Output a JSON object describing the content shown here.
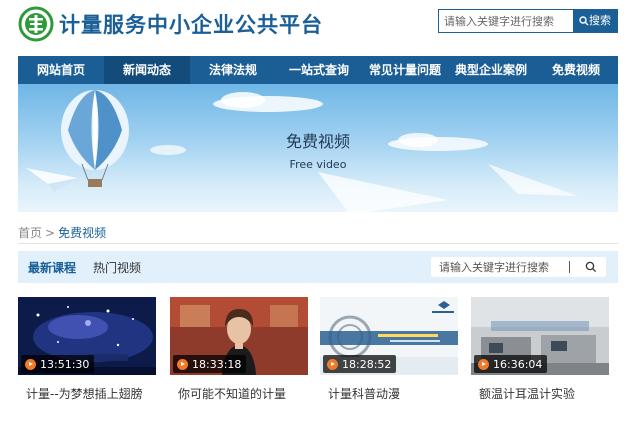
{
  "header": {
    "site_title": "计量服务中小企业公共平台",
    "search_placeholder": "请输入关键字进行搜索",
    "search_button": "搜索",
    "brand_color": "#1a5f96"
  },
  "nav": {
    "items": [
      {
        "label": "网站首页",
        "active": false
      },
      {
        "label": "新闻动态",
        "active": true
      },
      {
        "label": "法律法规",
        "active": false
      },
      {
        "label": "一站式查询",
        "active": false
      },
      {
        "label": "常见计量问题",
        "active": false
      },
      {
        "label": "典型企业案例",
        "active": false
      },
      {
        "label": "免费视频",
        "active": false
      }
    ]
  },
  "banner": {
    "title": "免费视频",
    "subtitle": "Free video"
  },
  "breadcrumb": {
    "home": "首页",
    "separator": ">",
    "current": "免费视频"
  },
  "tabs": {
    "items": [
      {
        "label": "最新课程",
        "active": true
      },
      {
        "label": "热门视频",
        "active": false
      }
    ],
    "search_placeholder": "请输入关键字进行搜索"
  },
  "videos": [
    {
      "title": "计量--为梦想插上翅膀",
      "duration": "13:51:30",
      "icon": "play-icon"
    },
    {
      "title": "你可能不知道的计量",
      "duration": "18:33:18",
      "icon": "play-icon"
    },
    {
      "title": "计量科普动漫",
      "duration": "18:28:52",
      "icon": "play-icon"
    },
    {
      "title": "额温计耳温计实验",
      "duration": "16:36:04",
      "icon": "play-icon"
    }
  ]
}
